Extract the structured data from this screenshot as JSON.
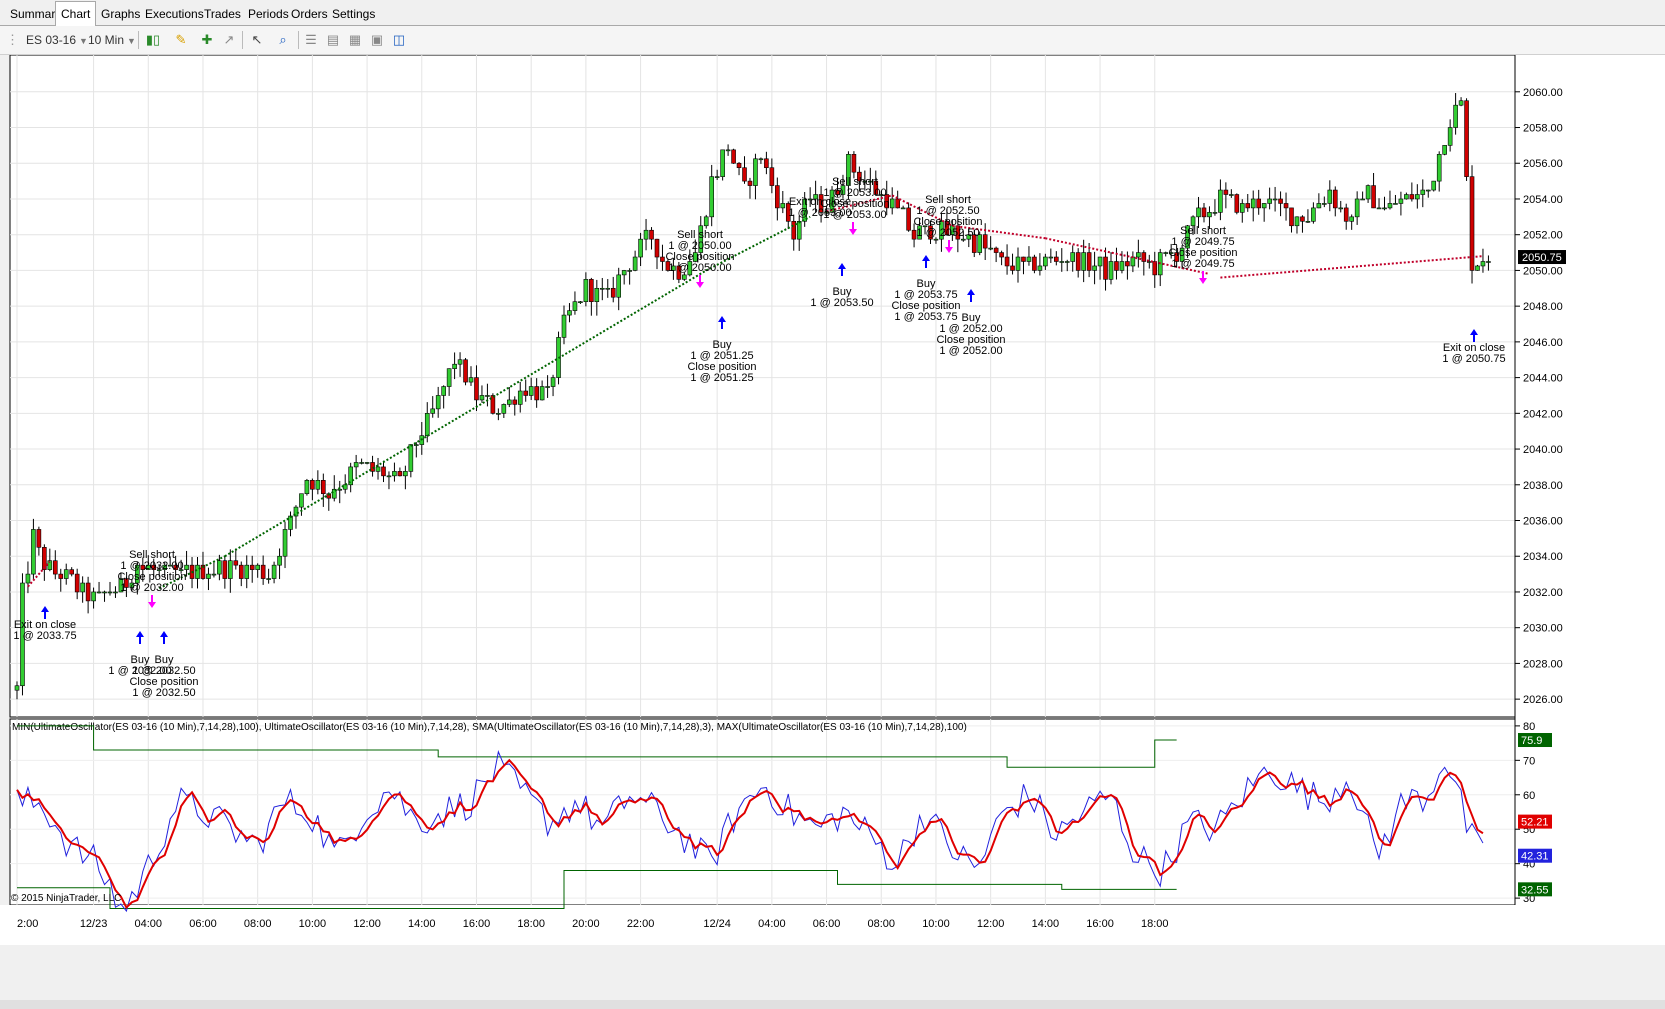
{
  "tabs": [
    "Summary",
    "Chart",
    "Graphs",
    "Executions",
    "Trades",
    "Periods",
    "Orders",
    "Settings"
  ],
  "active_tab": "Chart",
  "toolbar": {
    "instrument": "ES 03-16",
    "period": "10 Min",
    "icons": [
      "candlestick-style-icon",
      "pencil-draw-icon",
      "crosshair-icon",
      "measure-icon",
      "cursor-pointer-icon",
      "zoom-icon",
      "properties-icon",
      "indicators-icon",
      "strategies-icon",
      "data-box-icon",
      "panels-icon"
    ]
  },
  "chart_data": {
    "type": "candlestick",
    "instrument": "ES 03-16",
    "interval": "10 Min",
    "price_panel": {
      "y_ticks": [
        2026,
        2028,
        2030,
        2032,
        2034,
        2036,
        2038,
        2040,
        2042,
        2044,
        2046,
        2048,
        2050,
        2052,
        2054,
        2056,
        2058,
        2060
      ],
      "y_tick_labels": [
        "2026.00",
        "2028.00",
        "2030.00",
        "2032.00",
        "2034.00",
        "2036.00",
        "2038.00",
        "2040.00",
        "2042.00",
        "2044.00",
        "2046.00",
        "2048.00",
        "2050.00",
        "2052.00",
        "2054.00",
        "2056.00",
        "2058.00",
        "2060.00"
      ],
      "ylim": [
        2025,
        2061.5
      ],
      "last_price_label": "2050.75",
      "close_path": [
        [
          0,
          2026.5
        ],
        [
          1,
          2032
        ],
        [
          3,
          2035
        ],
        [
          5,
          2033.5
        ],
        [
          10,
          2032.5
        ],
        [
          14,
          2031.5
        ],
        [
          20,
          2032.5
        ],
        [
          22,
          2033.5
        ],
        [
          26,
          2033
        ],
        [
          30,
          2033
        ],
        [
          35,
          2033.2
        ],
        [
          40,
          2033.5
        ],
        [
          46,
          2033
        ],
        [
          50,
          2036
        ],
        [
          53,
          2038.5
        ],
        [
          57,
          2037.5
        ],
        [
          62,
          2039
        ],
        [
          66,
          2038.8
        ],
        [
          70,
          2038
        ],
        [
          73,
          2040.5
        ],
        [
          76,
          2042
        ],
        [
          80,
          2045
        ],
        [
          84,
          2043
        ],
        [
          88,
          2042.2
        ],
        [
          93,
          2043.5
        ],
        [
          97,
          2043
        ],
        [
          100,
          2047
        ],
        [
          104,
          2049
        ],
        [
          108,
          2048.5
        ],
        [
          112,
          2050.5
        ],
        [
          116,
          2052
        ],
        [
          118,
          2050.5
        ],
        [
          121,
          2050
        ],
        [
          124,
          2051
        ],
        [
          127,
          2055
        ],
        [
          130,
          2057
        ],
        [
          133,
          2054.5
        ],
        [
          136,
          2056.5
        ],
        [
          139,
          2054
        ],
        [
          142,
          2052
        ],
        [
          145,
          2054
        ],
        [
          148,
          2053.5
        ],
        [
          152,
          2056
        ],
        [
          155,
          2055
        ],
        [
          159,
          2054
        ],
        [
          162,
          2053
        ],
        [
          164,
          2052
        ],
        [
          168,
          2052.3
        ],
        [
          172,
          2052
        ],
        [
          176,
          2051.5
        ],
        [
          180,
          2050.5
        ],
        [
          184,
          2050.2
        ],
        [
          188,
          2050.5
        ],
        [
          192,
          2050.8
        ],
        [
          196,
          2050.3
        ],
        [
          200,
          2050
        ],
        [
          204,
          2050.7
        ],
        [
          208,
          2050.2
        ],
        [
          212,
          2051
        ],
        [
          216,
          2053
        ],
        [
          220,
          2054
        ],
        [
          224,
          2053.5
        ],
        [
          228,
          2054
        ],
        [
          232,
          2053.2
        ],
        [
          236,
          2053
        ],
        [
          240,
          2054.5
        ],
        [
          244,
          2052.5
        ],
        [
          246,
          2054.5
        ],
        [
          250,
          2053.5
        ],
        [
          254,
          2054
        ],
        [
          258,
          2054.5
        ],
        [
          260,
          2056.5
        ],
        [
          262,
          2058.5
        ],
        [
          264,
          2059.2
        ],
        [
          266,
          2050.5
        ],
        [
          268,
          2050.75
        ]
      ],
      "x_ticks": [
        {
          "i": 0,
          "label": "2:00"
        },
        {
          "i": 14,
          "label": "12/23"
        },
        {
          "i": 24,
          "label": "04:00"
        },
        {
          "i": 34,
          "label": "06:00"
        },
        {
          "i": 44,
          "label": "08:00"
        },
        {
          "i": 54,
          "label": "10:00"
        },
        {
          "i": 64,
          "label": "12:00"
        },
        {
          "i": 74,
          "label": "14:00"
        },
        {
          "i": 84,
          "label": "16:00"
        },
        {
          "i": 94,
          "label": "18:00"
        },
        {
          "i": 104,
          "label": "20:00"
        },
        {
          "i": 114,
          "label": "22:00"
        },
        {
          "i": 128,
          "label": "12/24"
        },
        {
          "i": 138,
          "label": "04:00"
        },
        {
          "i": 148,
          "label": "06:00"
        },
        {
          "i": 158,
          "label": "08:00"
        },
        {
          "i": 168,
          "label": "10:00"
        },
        {
          "i": 178,
          "label": "12:00"
        },
        {
          "i": 188,
          "label": "14:00"
        },
        {
          "i": 198,
          "label": "16:00"
        },
        {
          "i": 208,
          "label": "18:00"
        }
      ]
    },
    "trades": [
      {
        "entry": "Sell short",
        "entry_qty_price": "1 @ 2032.00",
        "exit": "Close position",
        "exit_qty_price": "1 @ 2032.00",
        "side": "short"
      },
      {
        "entry": "Buy",
        "entry_qty_price": "1 @ 2032.00",
        "exit": "",
        "exit_qty_price": "",
        "side": "long"
      },
      {
        "entry": "Buy",
        "entry_qty_price": "1 @ 2032.50",
        "exit": "Close position",
        "exit_qty_price": "1 @ 2032.50",
        "side": "long"
      },
      {
        "entry": "Sell short",
        "entry_qty_price": "1 @ 2050.00",
        "exit": "Close position",
        "exit_qty_price": "1 @ 2050.00",
        "side": "short"
      },
      {
        "entry": "Buy",
        "entry_qty_price": "1 @ 2051.25",
        "exit": "Close position",
        "exit_qty_price": "1 @ 2051.25",
        "side": "long"
      },
      {
        "entry": "Sell short",
        "entry_qty_price": "1 @ 2053.00",
        "exit": "Close position",
        "exit_qty_price": "1 @ 2053.00",
        "side": "short"
      },
      {
        "entry": "Buy",
        "entry_qty_price": "1 @ 2053.50",
        "exit": "",
        "exit_qty_price": "",
        "side": "long"
      },
      {
        "entry": "Sell short",
        "entry_qty_price": "1 @ 2052.50",
        "exit": "Close position",
        "exit_qty_price": "1 @ 2052.50",
        "side": "short"
      },
      {
        "entry": "Buy",
        "entry_qty_price": "1 @ 2053.75",
        "exit": "Close position",
        "exit_qty_price": "1 @ 2053.75",
        "side": "long"
      },
      {
        "entry": "Buy",
        "entry_qty_price": "1 @ 2052.00",
        "exit": "Close position",
        "exit_qty_price": "1 @ 2052.00",
        "side": "long"
      },
      {
        "entry": "Sell short",
        "entry_qty_price": "1 @ 2049.75",
        "exit": "Close position",
        "exit_qty_price": "1 @ 2049.75",
        "side": "short"
      }
    ],
    "exits_on_close": [
      {
        "label": "Exit on close",
        "qty_price": "1 @ 2033.75"
      },
      {
        "label": "Exit on close",
        "qty_price": "1 @ 2053.00"
      },
      {
        "label": "Exit on close",
        "qty_price": "1 @ 2050.75"
      }
    ],
    "oscillator_panel": {
      "title": "MIN(UltimateOscillator(ES 03-16 (10 Min),7,14,28),100), UltimateOscillator(ES 03-16 (10 Min),7,14,28), SMA(UltimateOscillator(ES 03-16 (10 Min),7,14,28),3), MAX(UltimateOscillator(ES 03-16 (10 Min),7,14,28),100)",
      "y_ticks": [
        30,
        40,
        50,
        60,
        70,
        80
      ],
      "ylim": [
        28,
        82
      ],
      "labels": {
        "max": "75.9",
        "sma": "52.21",
        "uo": "42.31",
        "min": "32.55"
      },
      "max_line": [
        [
          0,
          80
        ],
        [
          14,
          73
        ],
        [
          76,
          73
        ],
        [
          77,
          71
        ],
        [
          180,
          71
        ],
        [
          181,
          68
        ],
        [
          205,
          68
        ],
        [
          208,
          75.9
        ],
        [
          212,
          75.9
        ]
      ],
      "min_line": [
        [
          0,
          33
        ],
        [
          16,
          33
        ],
        [
          17,
          27
        ],
        [
          99,
          27
        ],
        [
          100,
          38
        ],
        [
          148,
          38
        ],
        [
          150,
          34
        ],
        [
          190,
          34
        ],
        [
          191,
          32.55
        ],
        [
          212,
          32.55
        ]
      ],
      "uo_anchors": [
        [
          0,
          58
        ],
        [
          4,
          57
        ],
        [
          8,
          45
        ],
        [
          12,
          40
        ],
        [
          16,
          26
        ],
        [
          20,
          40
        ],
        [
          24,
          58
        ],
        [
          28,
          55
        ],
        [
          32,
          50
        ],
        [
          36,
          45
        ],
        [
          40,
          58
        ],
        [
          44,
          55
        ],
        [
          48,
          42
        ],
        [
          52,
          55
        ],
        [
          56,
          62
        ],
        [
          60,
          52
        ],
        [
          64,
          55
        ],
        [
          68,
          58
        ],
        [
          72,
          68
        ],
        [
          76,
          60
        ],
        [
          80,
          52
        ],
        [
          84,
          58
        ],
        [
          88,
          50
        ],
        [
          92,
          60
        ],
        [
          96,
          55
        ],
        [
          100,
          48
        ],
        [
          104,
          40
        ],
        [
          108,
          55
        ],
        [
          112,
          63
        ],
        [
          116,
          55
        ],
        [
          120,
          50
        ],
        [
          124,
          55
        ],
        [
          128,
          48
        ],
        [
          132,
          40
        ],
        [
          136,
          55
        ],
        [
          140,
          45
        ],
        [
          144,
          38
        ],
        [
          148,
          55
        ],
        [
          152,
          60
        ],
        [
          156,
          48
        ],
        [
          160,
          55
        ],
        [
          164,
          60
        ],
        [
          168,
          42
        ],
        [
          172,
          38
        ],
        [
          176,
          52
        ],
        [
          180,
          50
        ],
        [
          184,
          60
        ],
        [
          188,
          68
        ],
        [
          192,
          62
        ],
        [
          196,
          58
        ],
        [
          200,
          66
        ],
        [
          204,
          42
        ],
        [
          208,
          58
        ],
        [
          212,
          60
        ],
        [
          214,
          72
        ],
        [
          216,
          62
        ],
        [
          218,
          48
        ],
        [
          220,
          42
        ]
      ]
    }
  }
}
